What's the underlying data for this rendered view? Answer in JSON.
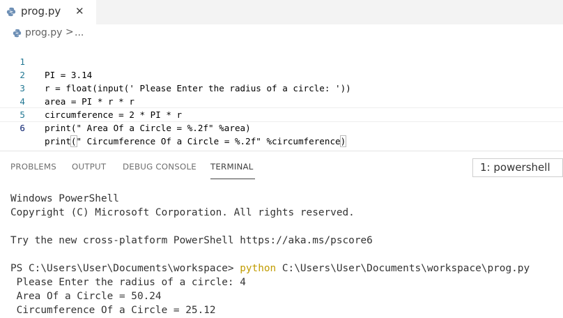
{
  "tab": {
    "filename": "prog.py",
    "close_glyph": "✕"
  },
  "breadcrumb": {
    "file": "prog.py",
    "separator": ">",
    "more": "..."
  },
  "editor": {
    "lines": [
      {
        "num": "1",
        "code": "PI = 3.14"
      },
      {
        "num": "2",
        "code": "r = float(input(' Please Enter the radius of a circle: '))"
      },
      {
        "num": "3",
        "code": "area = PI * r * r"
      },
      {
        "num": "4",
        "code": "circumference = 2 * PI * r"
      },
      {
        "num": "5",
        "code": "print(\" Area Of a Circle = %.2f\" %area)"
      },
      {
        "num": "6",
        "code_before": "print",
        "code_open": "(",
        "code_middle": "\" Circumference Of a Circle = %.2f\" %circumference",
        "code_close": ")"
      }
    ]
  },
  "panel": {
    "tabs": [
      "PROBLEMS",
      "OUTPUT",
      "DEBUG CONSOLE",
      "TERMINAL"
    ],
    "terminal_select": "1: powershell"
  },
  "terminal": {
    "l1": "Windows PowerShell",
    "l2": "Copyright (C) Microsoft Corporation. All rights reserved.",
    "l3": "",
    "l4": "Try the new cross-platform PowerShell https://aka.ms/pscore6",
    "l5": "",
    "prompt": "PS C:\\Users\\User\\Documents\\workspace> ",
    "cmd": "python",
    "cmd_args": " C:\\Users\\User\\Documents\\workspace\\prog.py",
    "o1": " Please Enter the radius of a circle: 4",
    "o2": " Area Of a Circle = 50.24",
    "o3": " Circumference Of a Circle = 25.12"
  },
  "colors": {
    "python_cmd": "#c19c00",
    "line_number": "#237893"
  }
}
